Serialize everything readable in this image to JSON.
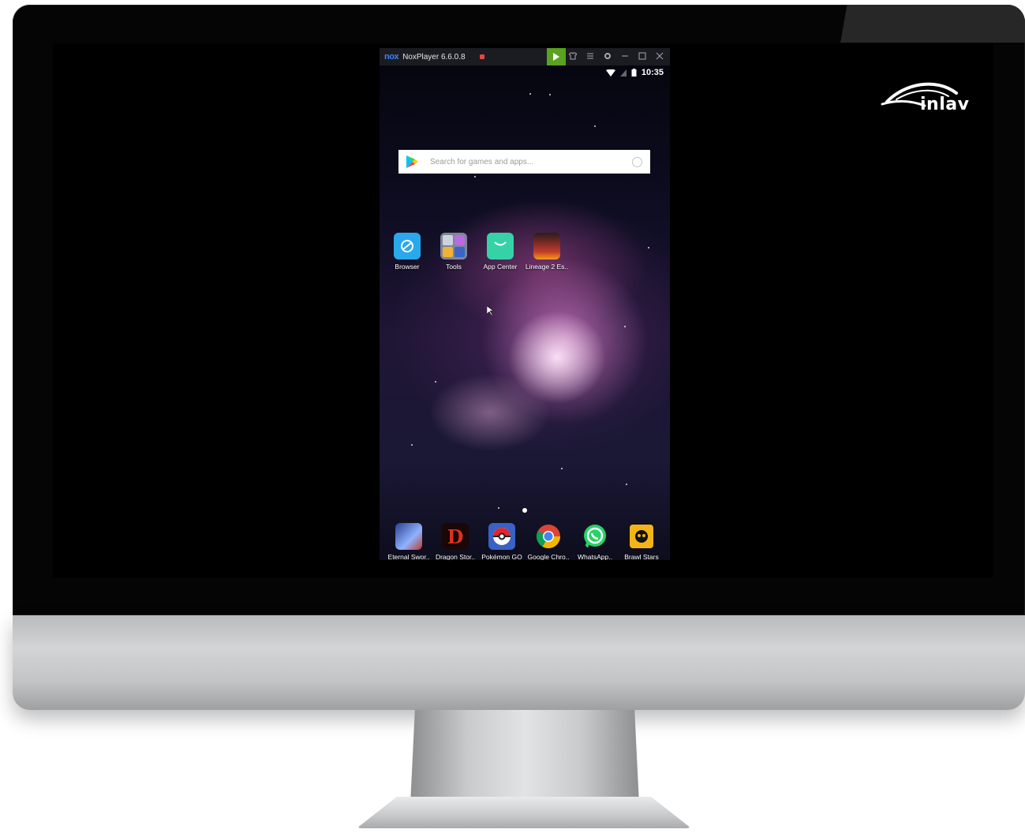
{
  "brand": {
    "logo_text": "inlav"
  },
  "emulator": {
    "title": "NoxPlayer 6.6.0.8",
    "logo": "nox",
    "toolbar_icons": [
      "play-store-icon",
      "shirt-icon",
      "menu-icon",
      "settings-icon",
      "minimize-icon",
      "maximize-icon",
      "close-icon"
    ]
  },
  "status_bar": {
    "time": "10:35"
  },
  "search": {
    "placeholder": "Search for games and apps..."
  },
  "home_apps": [
    {
      "label": "Browser",
      "color": "#2aa8ec"
    },
    {
      "label": "Tools",
      "color": "#9aa6b8"
    },
    {
      "label": "App Center",
      "color": "#35d2a8"
    },
    {
      "label": "Lineage 2 Es..",
      "color": "#c0392b"
    }
  ],
  "dock_apps": [
    {
      "label": "Eternal Swor..",
      "color": "#4a6fd1"
    },
    {
      "label": "Dragon Stor..",
      "color": "#e0301e"
    },
    {
      "label": "Pokémon GO",
      "color": "#3a62c4"
    },
    {
      "label": "Google Chro..",
      "color": "#ffffff"
    },
    {
      "label": "WhatsApp..",
      "color": "#25d366"
    },
    {
      "label": "Brawl Stars",
      "color": "#f2b418"
    }
  ]
}
